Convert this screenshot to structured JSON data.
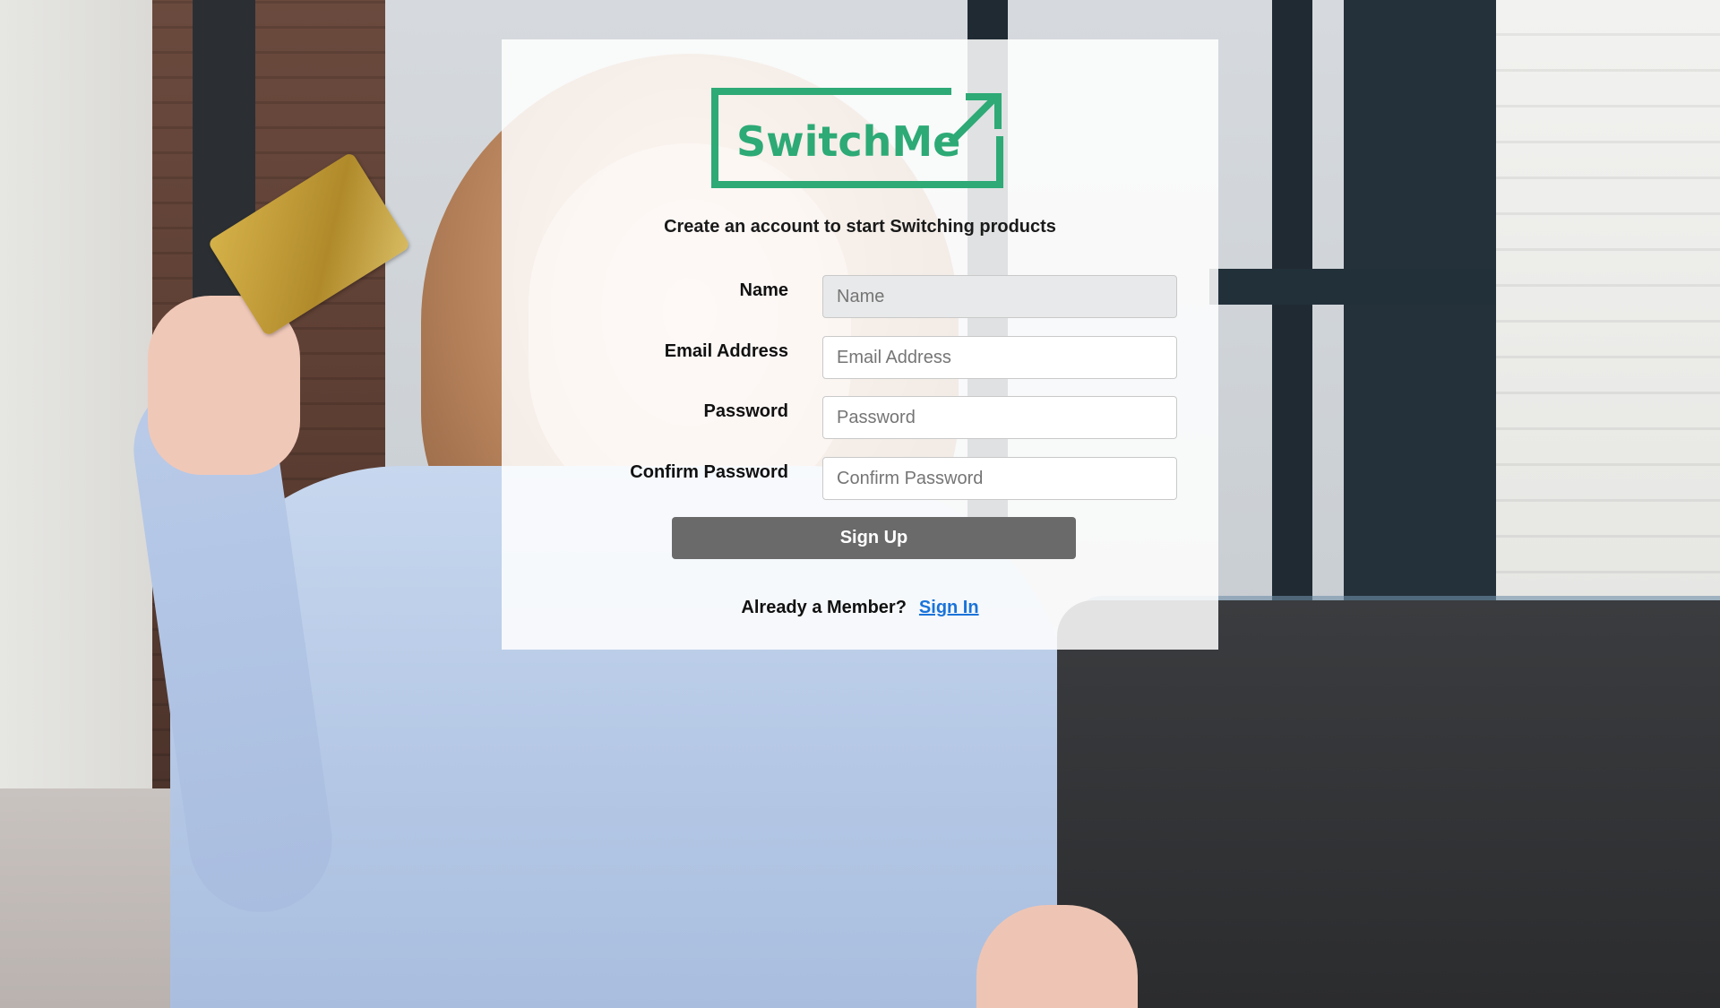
{
  "brand": {
    "name": "SwitchMe",
    "color": "#2daa76"
  },
  "signup": {
    "subtitle": "Create an account to start Switching products",
    "fields": {
      "name": {
        "label": "Name",
        "placeholder": "Name",
        "value": ""
      },
      "email": {
        "label": "Email Address",
        "placeholder": "Email Address",
        "value": ""
      },
      "password": {
        "label": "Password",
        "placeholder": "Password",
        "value": ""
      },
      "confirm_password": {
        "label": "Confirm Password",
        "placeholder": "Confirm Password",
        "value": ""
      }
    },
    "submit_label": "Sign Up",
    "member_prompt": "Already a Member?",
    "signin_link": "Sign In"
  },
  "icons": {
    "logo": "switchme-logo-arrow-icon"
  },
  "colors": {
    "button_bg": "#6a6a6a",
    "link": "#1a73d9",
    "card_bg": "rgba(255,255,255,0.86)"
  }
}
